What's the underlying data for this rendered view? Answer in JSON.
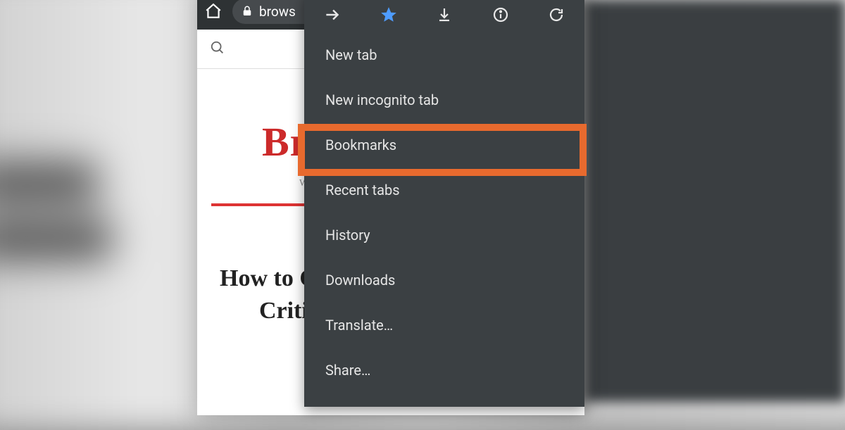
{
  "toolbar": {
    "url_fragment": "brows"
  },
  "page": {
    "brand": "Bro",
    "tagline": "We",
    "article_line1": "How to Cl",
    "article_line2": "Critica"
  },
  "menu": {
    "items": [
      "New tab",
      "New incognito tab",
      "Bookmarks",
      "Recent tabs",
      "History",
      "Downloads",
      "Translate…",
      "Share…"
    ]
  },
  "highlight": {
    "target_index": 2
  }
}
